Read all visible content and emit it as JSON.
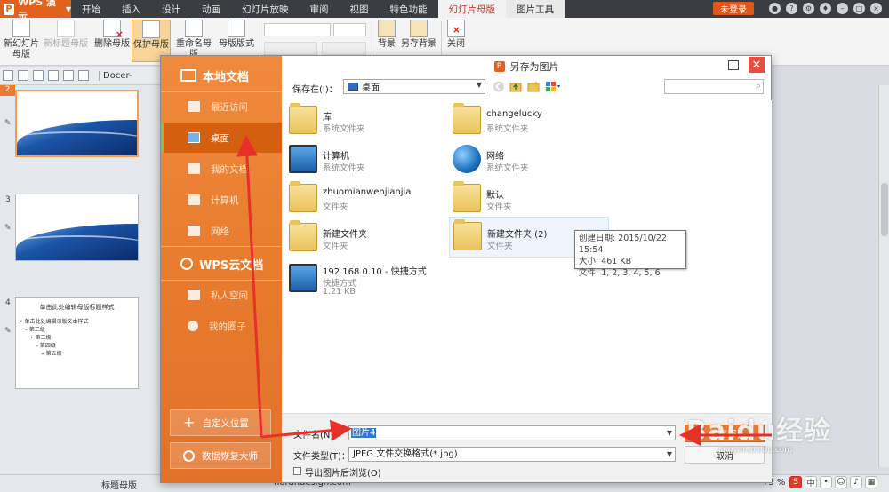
{
  "menubar": {
    "app_name": "WPS 演示",
    "items": [
      "开始",
      "插入",
      "设计",
      "动画",
      "幻灯片放映",
      "审阅",
      "视图",
      "特色功能",
      "幻灯片母版",
      "图片工具"
    ],
    "login": "未登录"
  },
  "ribbon": {
    "new_master": "新幻灯片\n母版",
    "new_title_master": "新标题母版",
    "delete_master": "删除母版",
    "protect_master": "保护母版",
    "rename_master": "重命名母版",
    "master_layout": "母版版式",
    "background": "背景",
    "save_background": "另存背景",
    "close": "关闭"
  },
  "qat": {
    "docer": "Docer-"
  },
  "slides": {
    "nums": [
      "2",
      "3",
      "4"
    ],
    "thumb4_title": "单击此处编辑母版标题样式",
    "thumb4_body": [
      "• 单击此处编辑母版文本样式",
      "– 第二级",
      "• 第三级",
      "– 第四级",
      "» 第五级"
    ]
  },
  "dialog": {
    "title": "另存为图片",
    "side": {
      "local_docs": "本地文档",
      "recent": "最近访问",
      "desktop": "桌面",
      "my_docs": "我的文档",
      "computer": "计算机",
      "network": "网络",
      "cloud_docs": "WPS云文档",
      "private_space": "私人空间",
      "my_circle": "我的圈子",
      "custom_location": "自定义位置",
      "data_recovery": "数据恢复大师"
    },
    "save_in_label": "保存在(I)：",
    "save_in_value": "桌面",
    "files": [
      {
        "name": "库",
        "type": "系统文件夹"
      },
      {
        "name": "changelucky",
        "type": "系统文件夹"
      },
      {
        "name": "计算机",
        "type": "系统文件夹"
      },
      {
        "name": "网络",
        "type": "系统文件夹"
      },
      {
        "name": "zhuomianwenjianjia",
        "type": "文件夹"
      },
      {
        "name": "默认",
        "type": "文件夹"
      },
      {
        "name": "新建文件夹",
        "type": "文件夹"
      },
      {
        "name": "新建文件夹 (2)",
        "type": "文件夹"
      },
      {
        "name": "192.168.0.10 - 快捷方式",
        "type": "快捷方式",
        "size": "1.21 KB"
      }
    ],
    "tooltip": {
      "created": "创建日期: 2015/10/22 15:54",
      "size": "大小: 461 KB",
      "files": "文件: 1, 2, 3, 4, 5, 6"
    },
    "filename_label": "文件名(N)：",
    "filename_value": "图片4",
    "filetype_label": "文件类型(T)：",
    "filetype_value": "JPEG 文件交换格式(*.jpg)",
    "save_btn": "保存(S)",
    "cancel_btn": "取消",
    "preview_label": "导出图片后浏览(O)"
  },
  "status": {
    "master": "标题母版",
    "url": "nordndesign.com",
    "zoom": "73 %"
  },
  "watermark": {
    "main": "Baidu经验",
    "sub": "jingyan.baidu.com"
  },
  "colors": {
    "accent": "#e97a30",
    "menubar": "#3a3d42",
    "annotation": "#e8302a"
  }
}
